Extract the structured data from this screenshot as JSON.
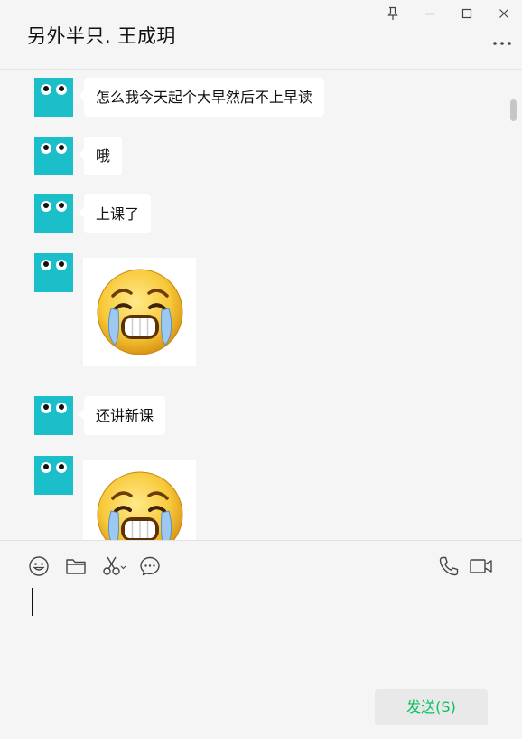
{
  "chat": {
    "title": "另外半只. 王成玥"
  },
  "messages": [
    {
      "type": "text",
      "text": "怎么我今天起个大早然后不上早读"
    },
    {
      "type": "text",
      "text": "哦"
    },
    {
      "type": "text",
      "text": "上课了"
    },
    {
      "type": "sticker",
      "icon": "crying-laughing-emoji-icon"
    },
    {
      "type": "text",
      "text": "还讲新课"
    },
    {
      "type": "sticker",
      "icon": "crying-laughing-emoji-icon"
    }
  ],
  "toolbar": {
    "left_icons": [
      "emoji-icon",
      "folder-icon",
      "scissors-icon",
      "chat-bubble-icon"
    ],
    "right_icons": [
      "phone-icon",
      "video-icon"
    ]
  },
  "composer": {
    "value": "",
    "send_label": "发送(S)"
  },
  "colors": {
    "avatar": "#1bbfc9",
    "send_text": "#07c160",
    "background": "#f5f5f5"
  }
}
